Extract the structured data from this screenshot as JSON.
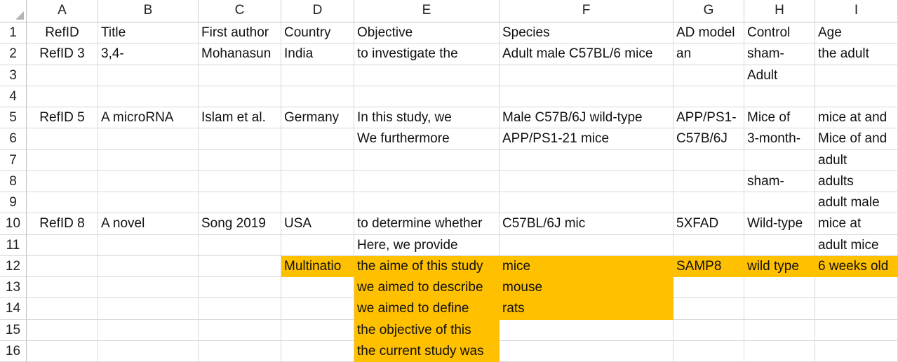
{
  "columns": [
    "A",
    "B",
    "C",
    "D",
    "E",
    "F",
    "G",
    "H",
    "I"
  ],
  "highlight_color": "#ffc000",
  "rows": [
    {
      "n": "1",
      "cells": [
        "RefID",
        "Title",
        "First author",
        "Country",
        "Objective",
        "Species",
        "AD model",
        "Control",
        "Age"
      ],
      "hl": []
    },
    {
      "n": "2",
      "cells": [
        "RefID 3",
        "3,4-",
        "Mohanasun",
        "India",
        "to investigate the",
        "Adult male C57BL/6 mice",
        "an",
        "sham-",
        "the adult"
      ],
      "hl": []
    },
    {
      "n": "3",
      "cells": [
        "",
        "",
        "",
        "",
        "",
        "",
        "",
        "Adult",
        ""
      ],
      "hl": []
    },
    {
      "n": "4",
      "cells": [
        "",
        "",
        "",
        "",
        "",
        "",
        "",
        "",
        ""
      ],
      "hl": []
    },
    {
      "n": "5",
      "cells": [
        "RefID 5",
        "A microRNA",
        "Islam et al.",
        "Germany",
        "In this study, we",
        "Male C57B/6J wild-type",
        "APP/PS1-",
        "Mice of",
        "mice at and"
      ],
      "hl": []
    },
    {
      "n": "6",
      "cells": [
        "",
        "",
        "",
        "",
        "We furthermore",
        "APP/PS1-21 mice",
        "C57B/6J",
        "3-month-",
        "Mice of and"
      ],
      "hl": []
    },
    {
      "n": "7",
      "cells": [
        "",
        "",
        "",
        "",
        "",
        "",
        "",
        "",
        "adult"
      ],
      "hl": []
    },
    {
      "n": "8",
      "cells": [
        "",
        "",
        "",
        "",
        "",
        "",
        "",
        "sham-",
        "adults"
      ],
      "hl": []
    },
    {
      "n": "9",
      "cells": [
        "",
        "",
        "",
        "",
        "",
        "",
        "",
        "",
        "adult male"
      ],
      "hl": []
    },
    {
      "n": "10",
      "cells": [
        "RefID 8",
        "A novel",
        "Song 2019",
        "USA",
        "to determine whether",
        "C57BL/6J mic",
        "5XFAD",
        "Wild-type",
        " mice at"
      ],
      "hl": []
    },
    {
      "n": "11",
      "cells": [
        "",
        "",
        "",
        "",
        "Here, we provide",
        "",
        "",
        "",
        "adult mice"
      ],
      "hl": []
    },
    {
      "n": "12",
      "cells": [
        "",
        "",
        "",
        "Multinatio",
        "the aime of this study",
        "mice",
        "SAMP8",
        "wild type",
        "6 weeks old"
      ],
      "hl": [
        3,
        4,
        5,
        6,
        7,
        8
      ]
    },
    {
      "n": "13",
      "cells": [
        "",
        "",
        "",
        "",
        "we aimed to describe",
        "mouse",
        "",
        "",
        ""
      ],
      "hl": [
        4,
        5
      ]
    },
    {
      "n": "14",
      "cells": [
        "",
        "",
        "",
        "",
        "we aimed to define",
        "rats",
        "",
        "",
        ""
      ],
      "hl": [
        4,
        5
      ]
    },
    {
      "n": "15",
      "cells": [
        "",
        "",
        "",
        "",
        "the objective of this",
        "",
        "",
        "",
        ""
      ],
      "hl": [
        4
      ]
    },
    {
      "n": "16",
      "cells": [
        "",
        "",
        "",
        "",
        "the current study was",
        "",
        "",
        "",
        ""
      ],
      "hl": [
        4
      ]
    }
  ]
}
